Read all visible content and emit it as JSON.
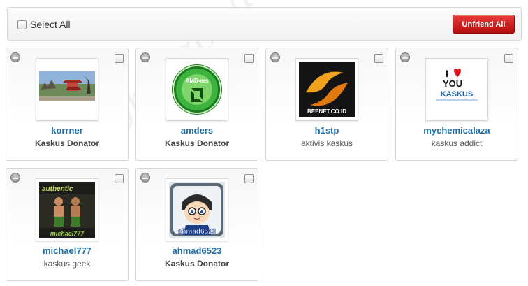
{
  "toolbar": {
    "select_all_label": "Select All",
    "unfriend_all_label": "Unfriend All"
  },
  "watermark": "ohsyzona",
  "friends": [
    {
      "name": "korrner",
      "title": "Kaskus Donator",
      "title_bold": true,
      "avatar": "temple-photo"
    },
    {
      "name": "amders",
      "title": "Kaskus Donator",
      "title_bold": true,
      "avatar": "amd-logo",
      "avatar_text": "AMD-ers"
    },
    {
      "name": "h1stp",
      "title": "aktivis kaskus",
      "title_bold": false,
      "avatar": "beenet-logo",
      "avatar_text": "BEENET.CO.ID"
    },
    {
      "name": "mychemicalaza",
      "title": "kaskus addict",
      "title_bold": false,
      "avatar": "i-love-kaskus",
      "avatar_text_1": "I",
      "avatar_text_2": "YOU",
      "avatar_text_3": "KASKUS"
    },
    {
      "name": "michael777",
      "title": "kaskus geek",
      "title_bold": false,
      "avatar": "wrestlers-image",
      "avatar_text_1": "authentic",
      "avatar_text_2": "michael777"
    },
    {
      "name": "ahmad6523",
      "title": "Kaskus Donator",
      "title_bold": true,
      "avatar": "cartoon-detective",
      "avatar_text": "ahmad6523"
    }
  ],
  "colors": {
    "link": "#1e6ea8",
    "button_red": "#c81515"
  }
}
